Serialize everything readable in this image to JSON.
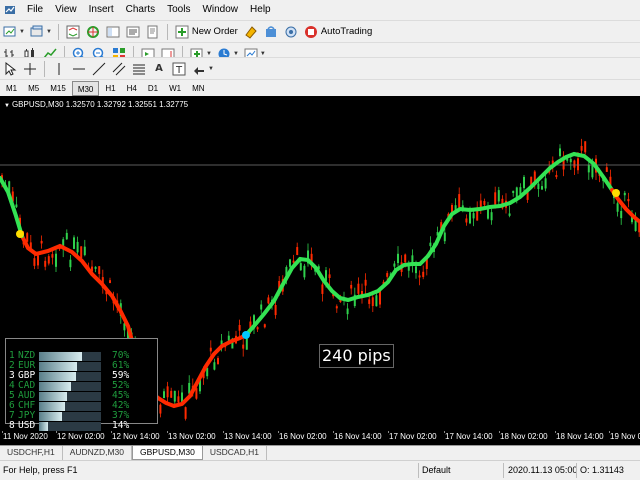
{
  "menu": [
    "File",
    "View",
    "Insert",
    "Charts",
    "Tools",
    "Window",
    "Help"
  ],
  "toolbar": {
    "new_order_label": "New Order",
    "autotrading_label": "AutoTrading"
  },
  "drawing_tools": {
    "text_label": "A",
    "text_label_tool": "T"
  },
  "timeframes": [
    "M1",
    "M5",
    "M15",
    "M30",
    "H1",
    "H4",
    "D1",
    "W1",
    "MN"
  ],
  "active_timeframe": "M30",
  "chart": {
    "symbol_info": "GBPUSD,M30  1.32570 1.32792 1.32551 1.32775",
    "pips_label": "240 pips",
    "x_ticks": [
      "11 Nov 2020",
      "12 Nov 02:00",
      "12 Nov 14:00",
      "13 Nov 02:00",
      "13 Nov 14:00",
      "16 Nov 02:00",
      "16 Nov 14:00",
      "17 Nov 02:00",
      "17 Nov 14:00",
      "18 Nov 02:00",
      "18 Nov 14:00",
      "19 Nov 0"
    ],
    "colors": {
      "uptrend": "#33e353",
      "downtrend": "#ff2a00",
      "signal_dot": "#ffdd00",
      "entry_dot": "#00c8ff",
      "price_line": "#7a7a7a"
    }
  },
  "strength_panel": {
    "rows": [
      {
        "rank": "1",
        "currency": "NZD",
        "percent": "70%",
        "value": 70,
        "color": "#1f9c3d"
      },
      {
        "rank": "2",
        "currency": "EUR",
        "percent": "61%",
        "value": 61,
        "color": "#1f9c3d"
      },
      {
        "rank": "3",
        "currency": "GBP",
        "percent": "59%",
        "value": 59,
        "color": "#ffffff"
      },
      {
        "rank": "4",
        "currency": "CAD",
        "percent": "52%",
        "value": 52,
        "color": "#1f9c3d"
      },
      {
        "rank": "5",
        "currency": "AUD",
        "percent": "45%",
        "value": 45,
        "color": "#1f9c3d"
      },
      {
        "rank": "6",
        "currency": "CHF",
        "percent": "42%",
        "value": 42,
        "color": "#1f9c3d"
      },
      {
        "rank": "7",
        "currency": "JPY",
        "percent": "37%",
        "value": 37,
        "color": "#1f9c3d"
      },
      {
        "rank": "8",
        "currency": "USD",
        "percent": "14%",
        "value": 14,
        "color": "#ffffff"
      }
    ]
  },
  "chart_tabs": [
    "USDCHF,H1",
    "AUDNZD,M30",
    "GBPUSD,M30",
    "USDCAD,H1"
  ],
  "active_tab": "GBPUSD,M30",
  "status": {
    "help": "For Help, press F1",
    "profile": "Default",
    "datetime": "2020.11.13 05:00",
    "open": "O: 1.31143"
  }
}
